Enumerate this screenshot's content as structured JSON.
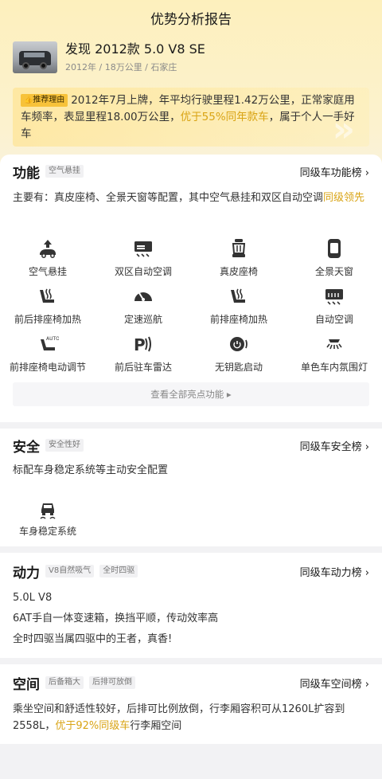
{
  "header": {
    "title": "优势分析报告"
  },
  "car": {
    "title": "发现 2012款 5.0 V8 SE",
    "subtitle": "2012年 / 18万公里 / 石家庄"
  },
  "reason": {
    "badge_label": "推荐理由",
    "text_1": "2012年7月上牌，年平均行驶里程1.42万公里，正常家庭用车频率，表显里程18.00万公里，",
    "highlight": "优于55%同年款车",
    "text_2": "，属于个人一手好车"
  },
  "function": {
    "title": "功能",
    "chip": "空气悬挂",
    "rank_label": "同级车功能榜 ›",
    "desc_1": "主要有：真皮座椅、全景天窗等配置，其中空气悬挂和双区自动空调",
    "desc_highlight": "同级领先",
    "features": [
      {
        "label": "空气悬挂",
        "icon": "air-suspension-icon"
      },
      {
        "label": "双区自动空调",
        "icon": "dual-zone-ac-icon"
      },
      {
        "label": "真皮座椅",
        "icon": "leather-seat-icon"
      },
      {
        "label": "全景天窗",
        "icon": "panoramic-sunroof-icon"
      },
      {
        "label": "前后排座椅加热",
        "icon": "seat-heating-icon"
      },
      {
        "label": "定速巡航",
        "icon": "cruise-control-icon"
      },
      {
        "label": "前排座椅加热",
        "icon": "front-seat-heating-icon"
      },
      {
        "label": "自动空调",
        "icon": "auto-ac-icon"
      },
      {
        "label": "前排座椅电动调节",
        "icon": "power-seat-icon"
      },
      {
        "label": "前后驻车雷达",
        "icon": "parking-radar-icon"
      },
      {
        "label": "无钥匙启动",
        "icon": "keyless-start-icon"
      },
      {
        "label": "单色车内氛围灯",
        "icon": "ambient-light-icon"
      }
    ],
    "view_all": "查看全部亮点功能 ▸"
  },
  "safety": {
    "title": "安全",
    "chip": "安全性好",
    "rank_label": "同级车安全榜 ›",
    "desc": "标配车身稳定系统等主动安全配置",
    "features": [
      {
        "label": "车身稳定系统",
        "icon": "stability-control-icon"
      }
    ]
  },
  "power": {
    "title": "动力",
    "chips": [
      "V8自然吸气",
      "全时四驱"
    ],
    "rank_label": "同级车动力榜 ›",
    "lines": [
      "5.0L V8",
      "6AT手自一体变速箱，换挡平顺，传动效率高",
      "全时四驱当属四驱中的王者，真香!"
    ]
  },
  "space": {
    "title": "空间",
    "chips": [
      "后备箱大",
      "后排可放倒"
    ],
    "rank_label": "同级车空间榜 ›",
    "desc_1": "乘坐空间和舒适性较好，后排可比例放倒，行李厢容积可从1260L扩容到2558L，",
    "desc_highlight": "优于92%同级车",
    "desc_2": "行李厢空间"
  },
  "colors": {
    "accent": "#d9a415",
    "badge": "#f7c23a"
  }
}
